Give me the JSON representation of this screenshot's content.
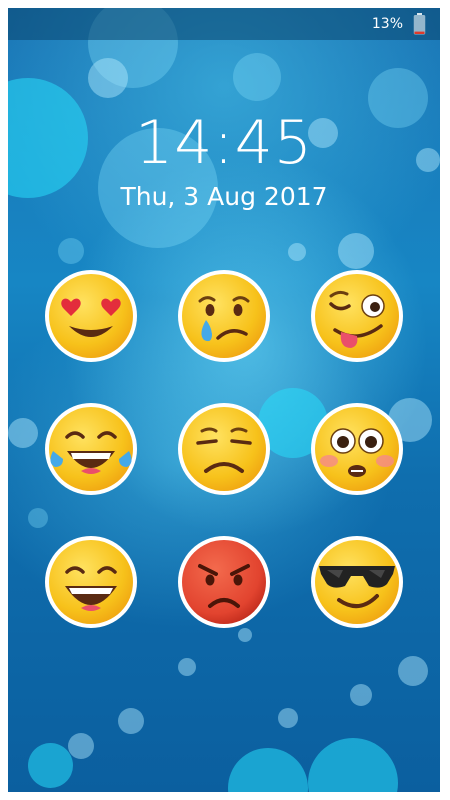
{
  "status_bar": {
    "battery_percent": "13%",
    "battery_level": 0.13,
    "battery_color": "#e03a2a"
  },
  "lockscreen": {
    "time": "14:45",
    "date": "Thu, 3 Aug 2017"
  },
  "emoji_pad": {
    "keys": [
      {
        "icon": "heart-eyes-emoji-icon"
      },
      {
        "icon": "crying-emoji-icon"
      },
      {
        "icon": "winking-tongue-emoji-icon"
      },
      {
        "icon": "tears-of-joy-emoji-icon"
      },
      {
        "icon": "sad-emoji-icon"
      },
      {
        "icon": "flushed-emoji-icon"
      },
      {
        "icon": "grinning-emoji-icon"
      },
      {
        "icon": "angry-emoji-icon"
      },
      {
        "icon": "sunglasses-emoji-icon"
      }
    ]
  },
  "colors": {
    "emoji_yellow": "#f7c21b",
    "emoji_border": "#ffffff",
    "angry_red": "#e2442f",
    "background_blue": "#1786c4"
  }
}
